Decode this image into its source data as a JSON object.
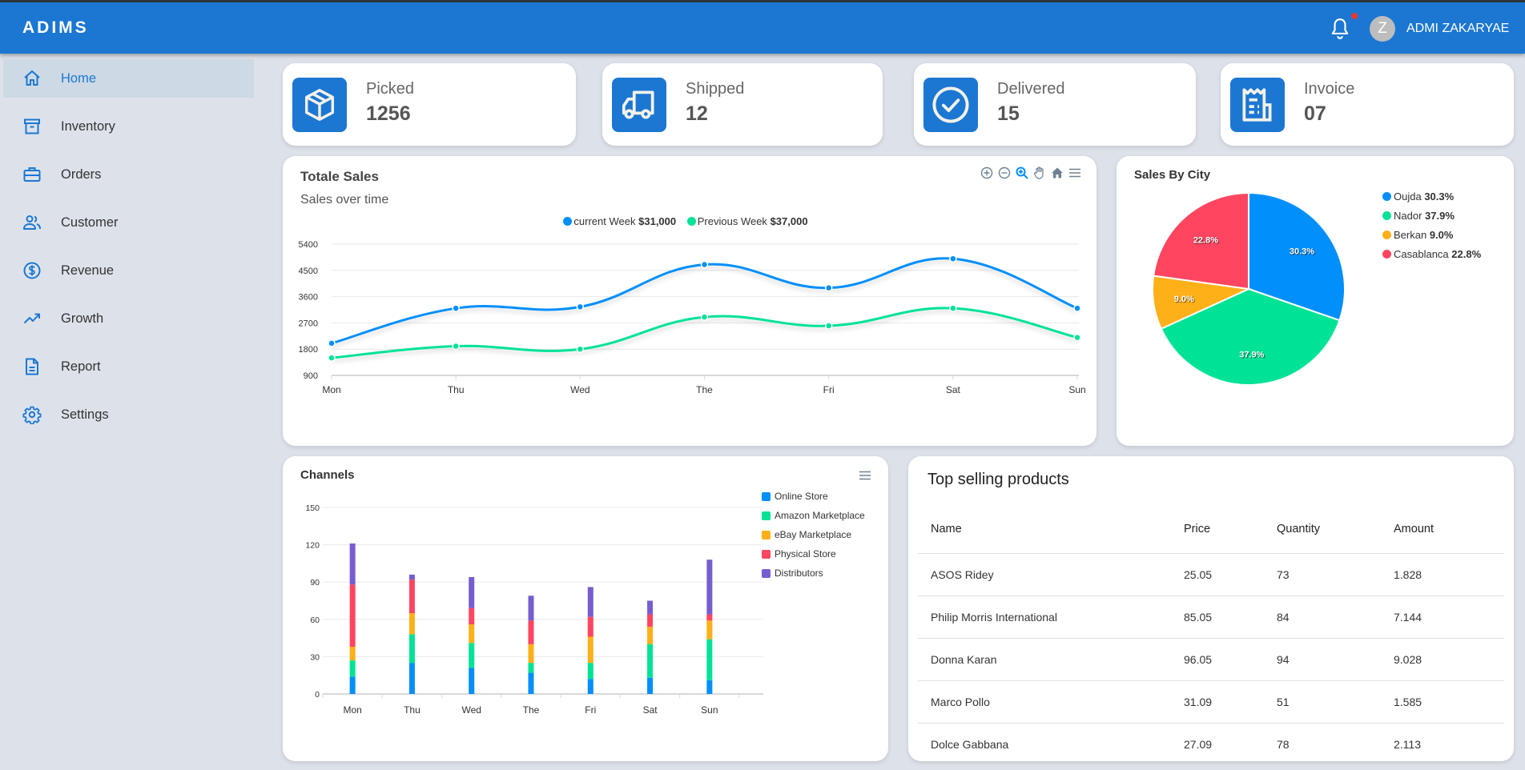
{
  "header": {
    "brand": "ADIMS",
    "avatar_initial": "Z",
    "username": "ADMI ZAKARYAE",
    "notification_icon": "bell-icon",
    "has_unread_notifications": true
  },
  "sidebar": {
    "items": [
      {
        "label": "Home",
        "icon": "home-icon",
        "active": true
      },
      {
        "label": "Inventory",
        "icon": "archive-icon",
        "active": false
      },
      {
        "label": "Orders",
        "icon": "briefcase-icon",
        "active": false
      },
      {
        "label": "Customer",
        "icon": "users-icon",
        "active": false
      },
      {
        "label": "Revenue",
        "icon": "dollar-circle-icon",
        "active": false
      },
      {
        "label": "Growth",
        "icon": "trending-up-icon",
        "active": false
      },
      {
        "label": "Report",
        "icon": "document-icon",
        "active": false
      },
      {
        "label": "Settings",
        "icon": "gear-icon",
        "active": false
      }
    ]
  },
  "stats": [
    {
      "label": "Picked",
      "value": "1256",
      "icon": "package-icon"
    },
    {
      "label": "Shipped",
      "value": "12",
      "icon": "truck-icon"
    },
    {
      "label": "Delivered",
      "value": "15",
      "icon": "check-circle-icon"
    },
    {
      "label": "Invoice",
      "value": "07",
      "icon": "receipt-icon"
    }
  ],
  "colors": {
    "primary": "#1b77d2",
    "blue": "#008ffb",
    "green": "#00e396",
    "orange": "#feb019",
    "red": "#ff4560",
    "purple": "#775dd0"
  },
  "total_sales": {
    "title": "Totale Sales",
    "subtitle": "Sales over time",
    "legend": [
      {
        "name": "current Week",
        "total": "$31,000"
      },
      {
        "name": "Previous Week",
        "total": "$37,000"
      }
    ],
    "toolbar": [
      "zoom-in-icon",
      "zoom-out-icon",
      "selection-zoom-icon",
      "pan-hand-icon",
      "reset-home-icon",
      "menu-icon"
    ]
  },
  "sales_by_city": {
    "title": "Sales By City"
  },
  "channels": {
    "title": "Channels"
  },
  "top_products": {
    "title": "Top selling products",
    "columns": [
      "Name",
      "Price",
      "Quantity",
      "Amount"
    ],
    "rows": [
      [
        "ASOS Ridey",
        "25.05",
        "73",
        "1.828"
      ],
      [
        "Philip Morris International",
        "85.05",
        "84",
        "7.144"
      ],
      [
        "Donna Karan",
        "96.05",
        "94",
        "9.028"
      ],
      [
        "Marco Pollo",
        "31.09",
        "51",
        "1.585"
      ],
      [
        "Dolce Gabbana",
        "27.09",
        "78",
        "2.113"
      ]
    ]
  },
  "chart_data": [
    {
      "type": "line",
      "title": "Totale Sales",
      "subtitle": "Sales over time",
      "categories": [
        "Mon",
        "Thu",
        "Wed",
        "The",
        "Fri",
        "Sat",
        "Sun"
      ],
      "series": [
        {
          "name": "current Week",
          "values": [
            2000,
            3200,
            3250,
            4700,
            3900,
            4900,
            3200
          ]
        },
        {
          "name": "Previous Week",
          "values": [
            1500,
            1900,
            1800,
            2900,
            2600,
            3200,
            2200
          ]
        }
      ],
      "yticks": [
        "5400",
        "4500",
        "3600",
        "2700",
        "1800",
        "900"
      ],
      "ylim": [
        900,
        5400
      ],
      "grid": true,
      "legend": "top-center",
      "curve": "smooth"
    },
    {
      "type": "pie",
      "title": "Sales By City",
      "labels": [
        "Oujda",
        "Nador",
        "Berkan",
        "Casablanca"
      ],
      "values": [
        30.3,
        37.9,
        9.0,
        22.8
      ],
      "value_labels": [
        "30.3%",
        "37.9%",
        "9.0%",
        "22.8%"
      ],
      "legend": "right"
    },
    {
      "type": "bar",
      "stacked": true,
      "title": "Channels",
      "categories": [
        "Mon",
        "Thu",
        "Wed",
        "The",
        "Fri",
        "Sat",
        "Sun"
      ],
      "series": [
        {
          "name": "Online Store",
          "values": [
            14,
            25,
            21,
            17,
            12,
            13,
            11
          ]
        },
        {
          "name": "Amazon Marketplace",
          "values": [
            13,
            23,
            20,
            8,
            13,
            27,
            33
          ]
        },
        {
          "name": "eBay Marketplace",
          "values": [
            11,
            17,
            15,
            15,
            21,
            14,
            15
          ]
        },
        {
          "name": "Physical Store",
          "values": [
            50,
            27,
            13,
            19,
            16,
            10,
            5
          ]
        },
        {
          "name": "Distributors",
          "values": [
            33,
            4,
            25,
            20,
            24,
            11,
            44
          ]
        }
      ],
      "yticks": [
        "150",
        "120",
        "90",
        "60",
        "30",
        "0"
      ],
      "ylim": [
        0,
        150
      ],
      "grid": true,
      "legend": "right"
    }
  ]
}
